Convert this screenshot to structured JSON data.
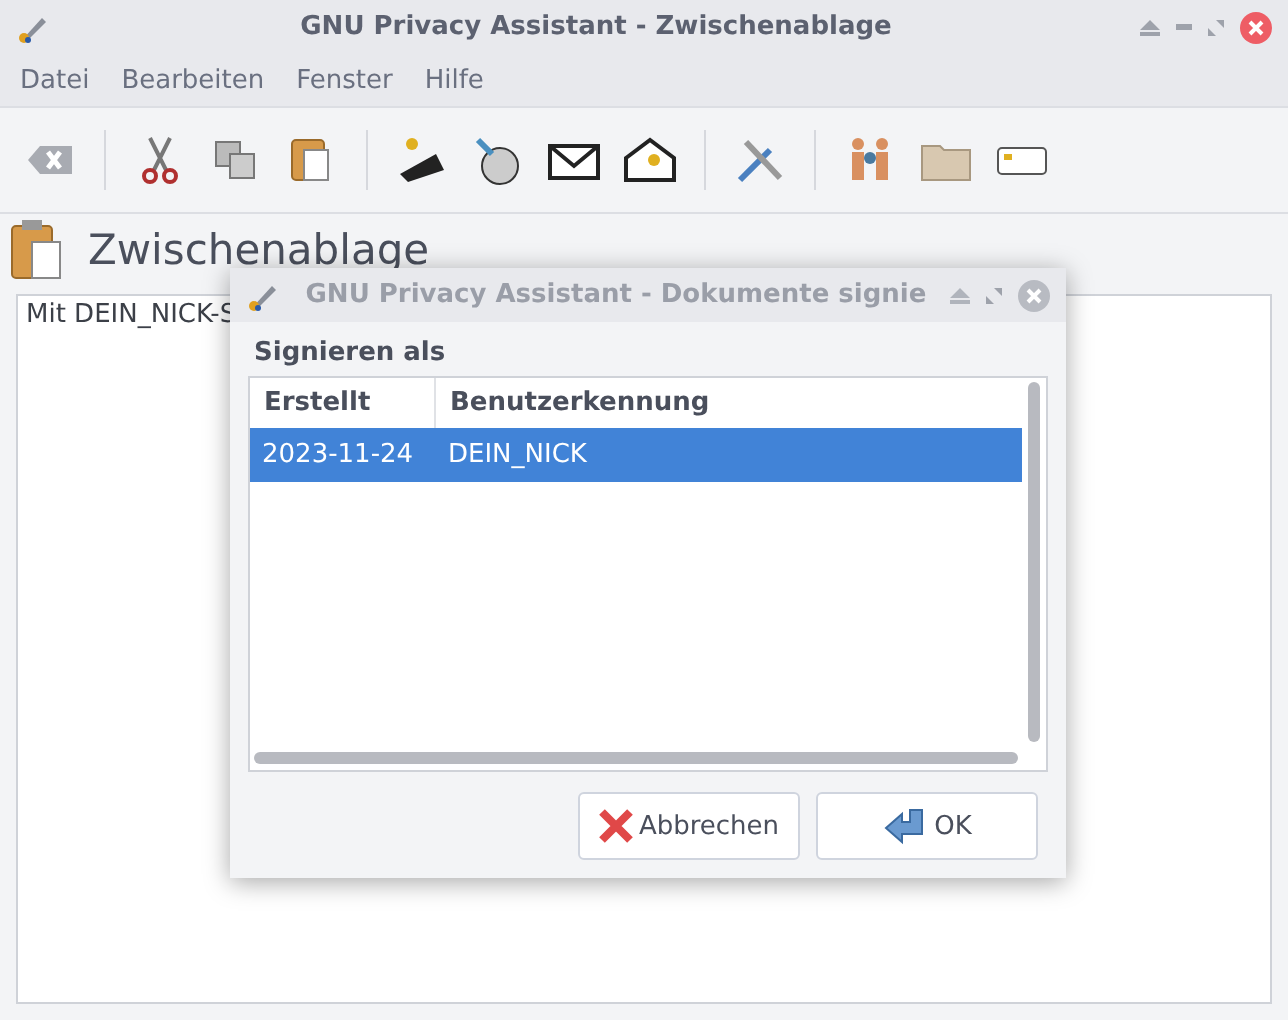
{
  "window": {
    "title": "GNU Privacy Assistant - Zwischenablage"
  },
  "menu": [
    "Datei",
    "Bearbeiten",
    "Fenster",
    "Hilfe"
  ],
  "page": {
    "heading": "Zwischenablage",
    "text": "Mit DEIN_NICK-S"
  },
  "dialog": {
    "title": "GNU Privacy Assistant - Dokumente signie",
    "section": "Signieren als",
    "columns": [
      "Erstellt",
      "Benutzerkennung"
    ],
    "rows": [
      {
        "cells": [
          "2023-11-24",
          "DEIN_NICK"
        ],
        "selected": true
      }
    ],
    "buttons": [
      {
        "label": "Abbrechen",
        "kind": "cancel"
      },
      {
        "label": "OK",
        "kind": "ok"
      }
    ]
  }
}
